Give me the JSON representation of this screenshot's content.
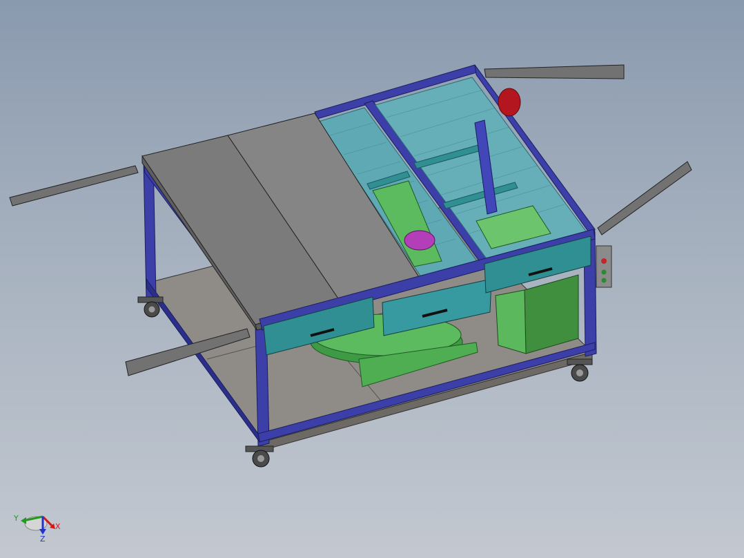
{
  "app": {
    "view": "isometric-shaded-with-edges",
    "background": {
      "top": "#8a9aae",
      "bottom": "#c3c8d0"
    }
  },
  "model": {
    "colors": {
      "frame": "#3c3fa8",
      "frame_dark": "#262a7a",
      "top_plate": "#7b7b7b",
      "top_plate_light": "#8c8c8c",
      "shelf": "#8f8b86",
      "drawer": "#2f8f93",
      "mesh": "#4ea3ad",
      "green_part": "#4fae52",
      "green_box": "#3f9a45",
      "magenta_part": "#b23fb8",
      "motor": "#b4161f",
      "arm": "#707070",
      "caster": "#4a4a4a"
    }
  },
  "triad": {
    "x_label": "X",
    "y_label": "Y",
    "z_label": "Z",
    "x_color": "#d11a1a",
    "y_color": "#1f9a1f",
    "z_color": "#2233cc"
  }
}
